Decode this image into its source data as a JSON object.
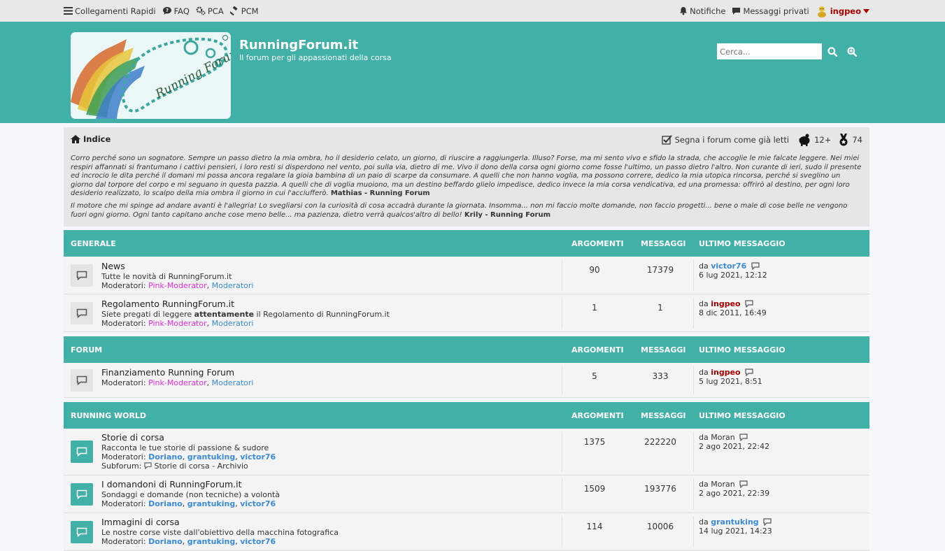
{
  "topbar": {
    "quick_links": "Collegamenti Rapidi",
    "faq": "FAQ",
    "pca": "PCA",
    "pcm": "PCM",
    "notifications": "Notifiche",
    "private_messages": "Messaggi privati",
    "username": "ingpeo"
  },
  "header": {
    "title": "RunningForum.it",
    "description": "Il forum per gli appassionati della corsa",
    "logo_text": "Running Forum",
    "search_placeholder": "Cerca..."
  },
  "intro": {
    "breadcrumb": "Indice",
    "mark_read": "Segna i forum come già letti",
    "badge_count": "12+",
    "medal_count": "74",
    "p1": "Corro perché sono un sognatore. Sempre un passo dietro la mia ombra, ho il desiderio celato, un giorno, di riuscire a raggiungerla. Illuso? Forse, ma mi sento vivo e sfido la strada, che accoglie le mie falcate leggere. Nei miei respiri affannati si frantumano i cattivi pensieri, i loro resti si disperdono nel vento, poi sulla via, dietro di me. Vivo il dono della corsa ogni giorno come fosse l'ultimo, un passo dietro l'altro. Non curante di ieri, sudo il presente ed incrocio le dita perché il domani mi possa ancora regalare la gioia bambina di un paio di scarpe da consumare. A quelli che non hanno voglia, ma possono correre, dedico la mia utopica rincorsa, perché si sveglino un giorno dal torpore del corpo e mi seguano in questa pazzia. A quelli che di voglia muoiono, ma un destino beffardo glielo impedisce, dedico invece la mia corsa vendicativa, ed una promessa: offrirò al destino, per ogni loro desiderio realizzato, lo scalpo della mia ombra il giorno in cui l'acciufferò.",
    "p1_sig": "Mathias - Running Forum",
    "p2": "Il motore che mi spinge ad andare avanti è l'allegria! Lo svegliarsi con la curiosità di cosa accadrà durante la giornata. Insomma... non mi faccio molte domande, non faccio progetti... bene o male di cose belle ne vengono fuori ogni giorno. Ogni tanto capitano anche cose meno belle... ma pazienza, dietro verrà qualcos'altro di bello!",
    "p2_sig": "Krily - Running Forum"
  },
  "columns": {
    "topics": "ARGOMENTI",
    "posts": "MESSAGGI",
    "last_post": "ULTIMO MESSAGGIO"
  },
  "labels": {
    "moderators": "Moderatori:",
    "by": "da",
    "subforum": "Subforum:"
  },
  "categories": [
    {
      "name": "GENERALE",
      "forums": [
        {
          "title": "News",
          "desc_html": "Tutte le novità di RunningForum.it",
          "mod1": "Pink-Moderator",
          "mod2": "Moderatori",
          "topics": "90",
          "posts": "17379",
          "last_user": "victor76",
          "last_date": "6 lug 2021, 12:12"
        },
        {
          "title": "Regolamento RunningForum.it",
          "desc_a": "Siete pregati di leggere",
          "desc_b": "attentamente",
          "desc_c": "il Regolamento di RunningForum.it",
          "mod1": "Pink-Moderator",
          "mod2": "Moderatori",
          "topics": "1",
          "posts": "1",
          "last_user": "ingpeo",
          "last_date": "8 dic 2011, 16:49"
        }
      ]
    },
    {
      "name": "FORUM",
      "forums": [
        {
          "title": "Finanziamento Running Forum",
          "mod1": "Pink-Moderator",
          "mod2": "Moderatori",
          "topics": "5",
          "posts": "333",
          "last_user": "ingpeo",
          "last_date": "5 lug 2021, 8:51"
        }
      ]
    },
    {
      "name": "RUNNING WORLD",
      "forums": [
        {
          "title": "Storie di corsa",
          "desc": "Racconta le tue storie di passione & sudore",
          "mod1": "Doriano",
          "mod2": "grantuking",
          "mod3": "victor76",
          "subforum": "Storie di corsa - Archivio",
          "topics": "1375",
          "posts": "222220",
          "last_user": "Moran",
          "last_date": "2 ago 2021, 22:42"
        },
        {
          "title": "I domandoni di RunningForum.it",
          "desc": "Sondaggi e domande (non tecniche) a volontà",
          "mod1": "Doriano",
          "mod2": "grantuking",
          "mod3": "victor76",
          "topics": "1509",
          "posts": "193776",
          "last_user": "Moran",
          "last_date": "2 ago 2021, 22:39"
        },
        {
          "title": "Immagini di corsa",
          "desc": "Le nostre corse viste dall'obiettivo della macchina fotografica",
          "mod1": "Doriano",
          "mod2": "grantuking",
          "mod3": "victor76",
          "topics": "114",
          "posts": "10006",
          "last_user": "grantuking",
          "last_date": "14 lug 2021, 14:23"
        }
      ]
    }
  ],
  "colors": {
    "accent": "#41b0a6",
    "user_red": "#aa0000",
    "link_blue": "#3a8ad8",
    "mod_pink": "#e62ce0"
  }
}
